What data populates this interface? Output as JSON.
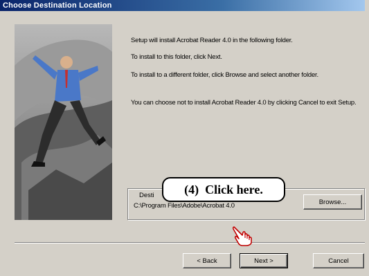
{
  "window": {
    "title": "Choose Destination Location"
  },
  "body": {
    "p1": "Setup will install Acrobat Reader 4.0 in the following folder.",
    "p2": "To install to this folder, click Next.",
    "p3": "To install to a different folder, click Browse and select another folder.",
    "p4": "You can choose not to install Acrobat Reader 4.0 by clicking Cancel to exit Setup."
  },
  "destination": {
    "group_label": "Desti",
    "path": "C:\\Program Files\\Adobe\\Acrobat 4.0",
    "browse_label": "Browse..."
  },
  "footer": {
    "back_label": "< Back",
    "next_label": "Next >",
    "cancel_label": "Cancel"
  },
  "callout": {
    "text": "(4)  Click here."
  },
  "icons": {
    "hand": "pointing-hand-icon"
  }
}
